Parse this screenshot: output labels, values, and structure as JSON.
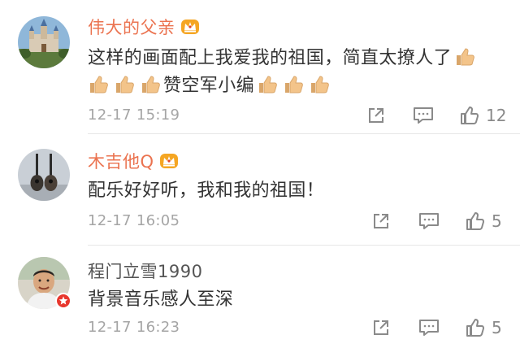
{
  "comments": [
    {
      "name": "伟大的父亲",
      "name_style": "vip",
      "text": "这样的画面配上我爱我的祖国，简直太撩人了",
      "text2": "赞空军小编",
      "time": "12-17 15:19",
      "likes": "12",
      "avatar_icon": "castle-photo"
    },
    {
      "name": "木吉他Q",
      "name_style": "vip",
      "text": "配乐好好听，我和我的祖国！",
      "time": "12-17 16:05",
      "likes": "5",
      "avatar_icon": "guitars-photo"
    },
    {
      "name": "程门立雪1990",
      "name_style": "plain",
      "text": "背景音乐感人至深",
      "time": "12-17 16:23",
      "likes": "5",
      "avatar_icon": "person-photo"
    }
  ],
  "colors": {
    "vip_name": "#eb7350",
    "text": "#333333",
    "meta": "#a5a5a5",
    "icon": "#8a8a8a",
    "crown": "#f5a623",
    "thumb": "#f3c48a"
  }
}
